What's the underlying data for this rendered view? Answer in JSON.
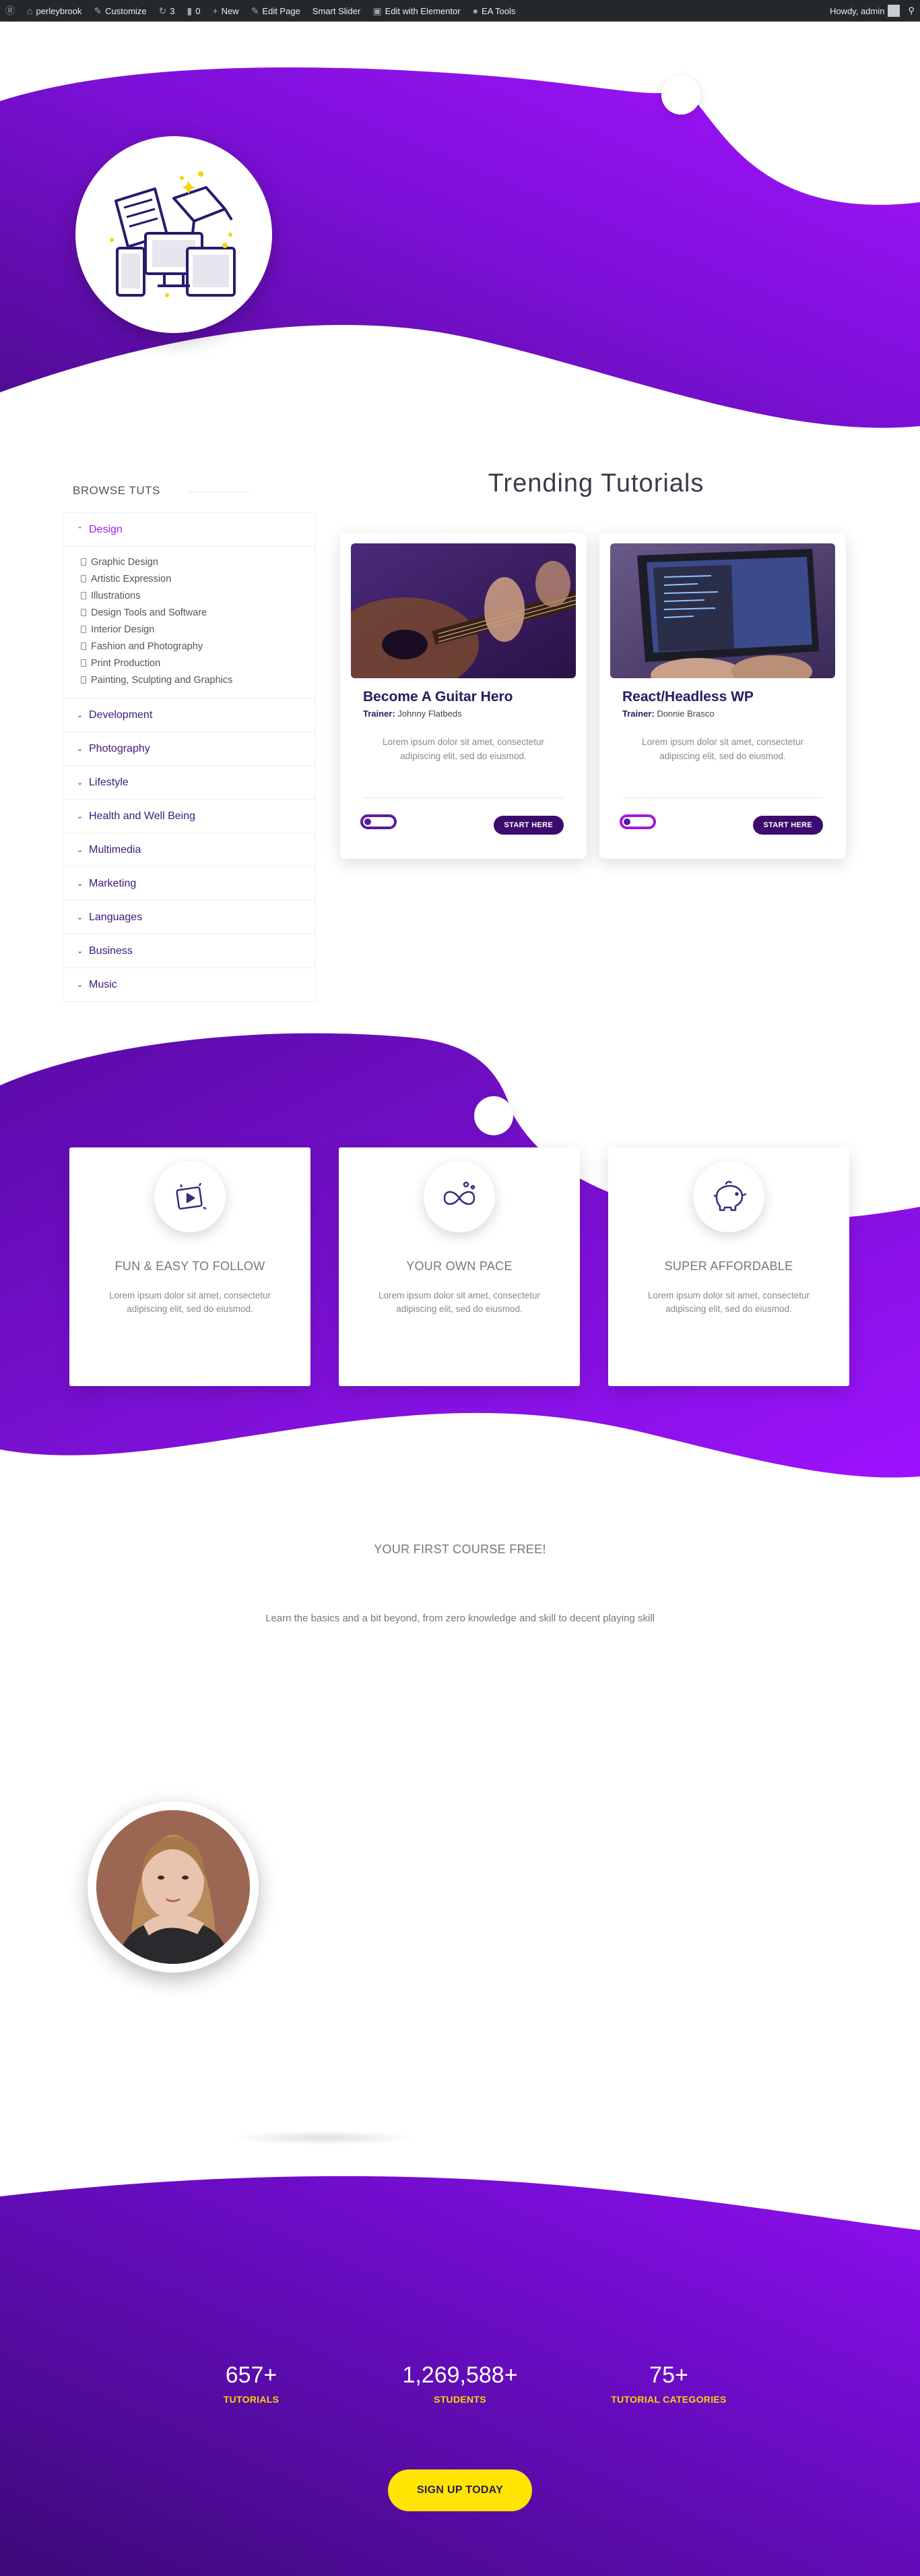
{
  "adminbar": {
    "site_name": "perleybrook",
    "customize": "Customize",
    "updates": "3",
    "comments": "0",
    "new": "New",
    "edit_page": "Edit Page",
    "smart_slider": "Smart Slider",
    "edit_elementor": "Edit with Elementor",
    "ea_tools": "EA Tools",
    "howdy": "Howdy, admin"
  },
  "sidebar": {
    "title": "BROWSE TUTS",
    "categories": [
      {
        "label": "Design",
        "open": true,
        "links": [
          "Graphic Design",
          "Artistic Expression",
          "Illustrations",
          "Design Tools and Software",
          "Interior Design",
          "Fashion and Photography",
          "Print Production",
          "Painting, Sculpting and Graphics"
        ]
      },
      {
        "label": "Development"
      },
      {
        "label": "Photography"
      },
      {
        "label": "Lifestyle"
      },
      {
        "label": "Health and Well Being"
      },
      {
        "label": "Multimedia"
      },
      {
        "label": "Marketing"
      },
      {
        "label": "Languages"
      },
      {
        "label": "Business"
      },
      {
        "label": "Music"
      }
    ]
  },
  "trending": {
    "title": "Trending Tutorials",
    "courses": [
      {
        "name": "Become A Guitar Hero",
        "trainer_label": "Trainer:",
        "trainer": "Johnny Flatbeds",
        "desc": "Lorem ipsum dolor sit amet, consectetur adipiscing elit, sed do eiusmod.",
        "button": "START HERE"
      },
      {
        "name": "React/Headless WP",
        "trainer_label": "Trainer:",
        "trainer": "Donnie Brasco",
        "desc": "Lorem ipsum dolor sit amet, consectetur adipiscing elit, sed do eiusmod.",
        "button": "START HERE"
      }
    ]
  },
  "features": [
    {
      "title": "FUN & EASY TO FOLLOW",
      "text": "Lorem ipsum dolor sit amet, consectetur adipiscing elit, sed do eiusmod.",
      "icon": "video-play-icon"
    },
    {
      "title": "YOUR OWN PACE",
      "text": "Lorem ipsum dolor sit amet, consectetur adipiscing elit, sed do eiusmod.",
      "icon": "infinity-icon"
    },
    {
      "title": "SUPER AFFORDABLE",
      "text": "Lorem ipsum dolor sit amet, consectetur adipiscing elit, sed do eiusmod.",
      "icon": "piggy-bank-icon"
    }
  ],
  "free_course": {
    "title": "YOUR FIRST COURSE FREE!",
    "subtitle": "Learn the basics and a bit beyond, from zero knowledge and skill to decent playing skill"
  },
  "stats": [
    {
      "value": "657+",
      "label": "TUTORIALS"
    },
    {
      "value": "1,269,588+",
      "label": "STUDENTS"
    },
    {
      "value": "75+",
      "label": "TUTORIAL CATEGORIES"
    }
  ],
  "cta": {
    "label": "SIGN UP TODAY"
  },
  "colors": {
    "purple_dark": "#4a0a8a",
    "purple_bright": "#9d12ff",
    "accent_yellow": "#ffe500",
    "heading_navy": "#2a1a5e"
  }
}
